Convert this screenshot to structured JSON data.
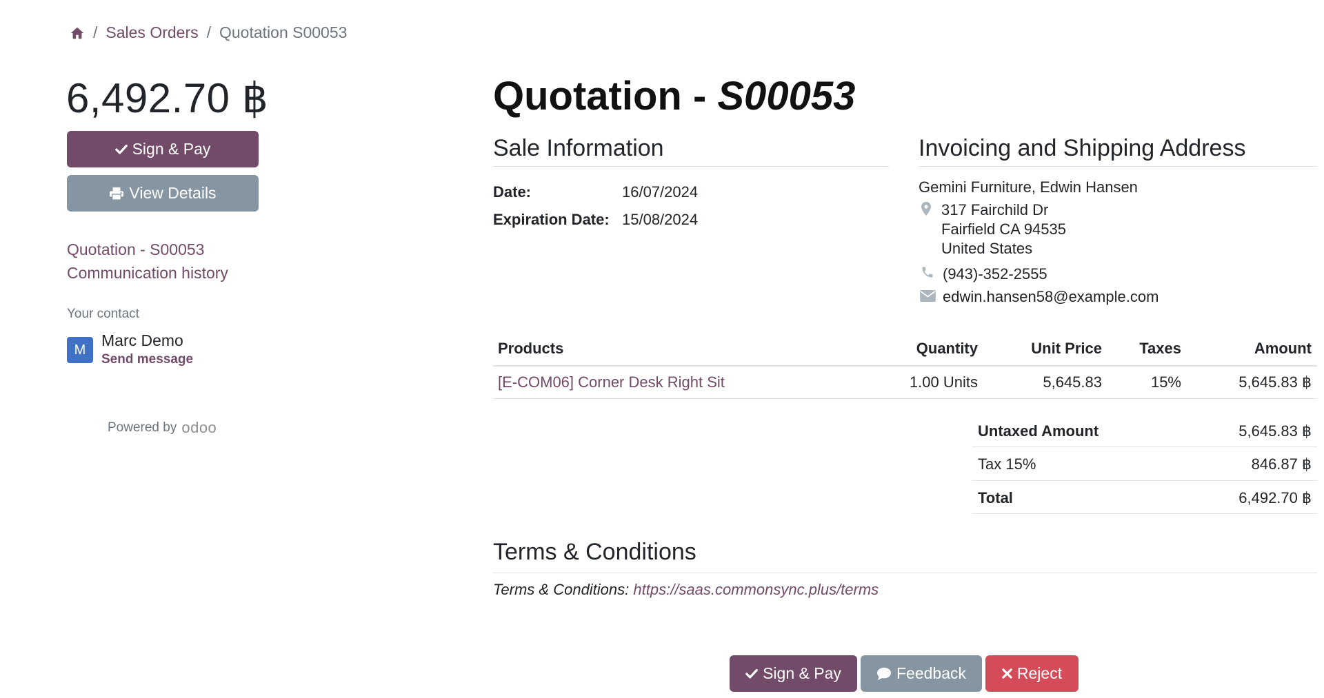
{
  "breadcrumb": {
    "home_icon": "home-icon",
    "sales_orders": "Sales Orders",
    "current": "Quotation S00053"
  },
  "sidebar": {
    "total": "6,492.70 ฿",
    "sign_pay_label": "Sign & Pay",
    "view_details_label": "View Details",
    "links": [
      "Quotation - S00053",
      "Communication history"
    ],
    "contact_label": "Your contact",
    "contact_initial": "M",
    "contact_name": "Marc Demo",
    "send_message": "Send message",
    "powered_by": "Powered by",
    "powered_brand": "odoo"
  },
  "main": {
    "title_prefix": "Quotation - ",
    "title_ref": "S00053",
    "sale_info": {
      "title": "Sale Information",
      "date_label": "Date:",
      "date_value": "16/07/2024",
      "expiration_label": "Expiration Date:",
      "expiration_value": "15/08/2024"
    },
    "address": {
      "title": "Invoicing and Shipping Address",
      "name": "Gemini Furniture, Edwin Hansen",
      "lines": [
        "317 Fairchild Dr",
        "Fairfield CA 94535",
        "United States"
      ],
      "phone": "(943)-352-2555",
      "email": "edwin.hansen58@example.com"
    },
    "table": {
      "headers": [
        "Products",
        "Quantity",
        "Unit Price",
        "Taxes",
        "Amount"
      ],
      "rows": [
        {
          "product": "[E-COM06] Corner Desk Right Sit",
          "quantity": "1.00 Units",
          "unit_price": "5,645.83",
          "taxes": "15%",
          "amount": "5,645.83 ฿"
        }
      ]
    },
    "totals": [
      {
        "label": "Untaxed Amount",
        "value": "5,645.83 ฿"
      },
      {
        "label": "Tax 15%",
        "value": "846.87 ฿"
      },
      {
        "label": "Total",
        "value": "6,492.70 ฿"
      }
    ],
    "terms": {
      "title": "Terms & Conditions",
      "prefix": "Terms & Conditions: ",
      "url": "https://saas.commonsync.plus/terms"
    }
  },
  "actions": {
    "sign_pay": "Sign & Pay",
    "feedback": "Feedback",
    "reject": "Reject"
  },
  "colors": {
    "primary": "#714b67",
    "secondary": "#8595a2",
    "danger": "#d44c59",
    "avatar": "#3f71c4"
  }
}
